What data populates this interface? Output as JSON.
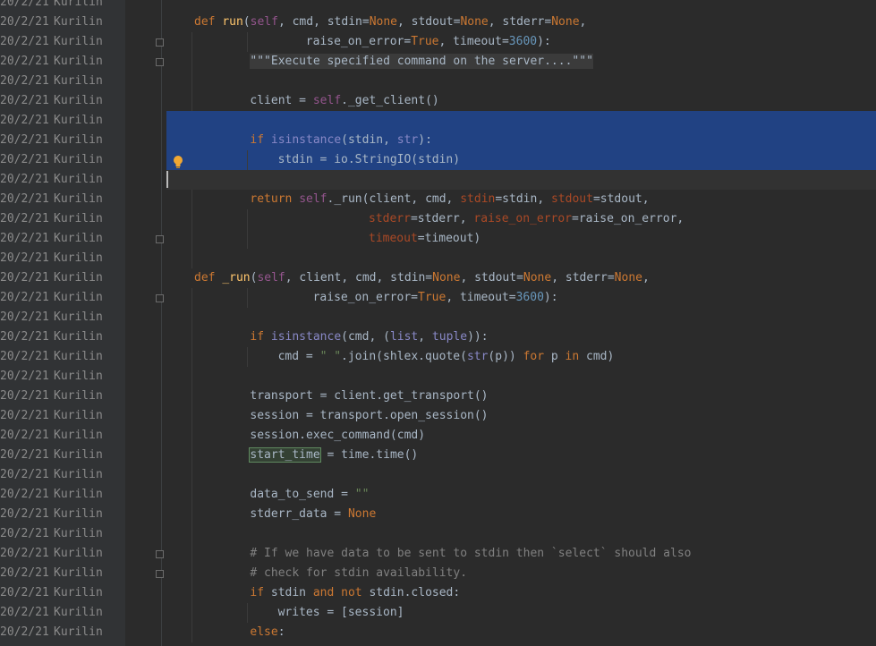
{
  "editor": {
    "annotation_rows": [
      {
        "date": "20/2/21",
        "author": "Kurilin"
      },
      {
        "date": "20/2/21",
        "author": "Kurilin"
      },
      {
        "date": "20/2/21",
        "author": "Kurilin"
      },
      {
        "date": "20/2/21",
        "author": "Kurilin"
      },
      {
        "date": "20/2/21",
        "author": "Kurilin"
      },
      {
        "date": "20/2/21",
        "author": "Kurilin"
      },
      {
        "date": "20/2/21",
        "author": "Kurilin"
      },
      {
        "date": "20/2/21",
        "author": "Kurilin"
      },
      {
        "date": "20/2/21",
        "author": "Kurilin"
      },
      {
        "date": "20/2/21",
        "author": "Kurilin"
      },
      {
        "date": "20/2/21",
        "author": "Kurilin"
      },
      {
        "date": "20/2/21",
        "author": "Kurilin"
      },
      {
        "date": "20/2/21",
        "author": "Kurilin"
      },
      {
        "date": "20/2/21",
        "author": "Kurilin"
      },
      {
        "date": "20/2/21",
        "author": "Kurilin"
      },
      {
        "date": "20/2/21",
        "author": "Kurilin"
      },
      {
        "date": "20/2/21",
        "author": "Kurilin"
      },
      {
        "date": "20/2/21",
        "author": "Kurilin"
      },
      {
        "date": "20/2/21",
        "author": "Kurilin"
      },
      {
        "date": "20/2/21",
        "author": "Kurilin"
      },
      {
        "date": "20/2/21",
        "author": "Kurilin"
      },
      {
        "date": "20/2/21",
        "author": "Kurilin"
      },
      {
        "date": "20/2/21",
        "author": "Kurilin"
      },
      {
        "date": "20/2/21",
        "author": "Kurilin"
      },
      {
        "date": "20/2/21",
        "author": "Kurilin"
      },
      {
        "date": "20/2/21",
        "author": "Kurilin"
      },
      {
        "date": "20/2/21",
        "author": "Kurilin"
      },
      {
        "date": "20/2/21",
        "author": "Kurilin"
      },
      {
        "date": "20/2/21",
        "author": "Kurilin"
      },
      {
        "date": "20/2/21",
        "author": "Kurilin"
      },
      {
        "date": "20/2/21",
        "author": "Kurilin"
      },
      {
        "date": "20/2/21",
        "author": "Kurilin"
      },
      {
        "date": "20/2/21",
        "author": "Kurilin"
      }
    ],
    "code_lines": [
      {
        "indent": 0,
        "tokens": [
          [
            "def ",
            "kw"
          ],
          [
            "run",
            "fn"
          ],
          [
            "(",
            ""
          ],
          [
            "self",
            "self"
          ],
          [
            ", cmd, stdin=",
            ""
          ],
          [
            "None",
            "kw"
          ],
          [
            ", stdout=",
            ""
          ],
          [
            "None",
            "kw"
          ],
          [
            ", stderr=",
            ""
          ],
          [
            "None",
            "kw"
          ],
          [
            ",",
            ""
          ]
        ]
      },
      {
        "indent": 16,
        "tokens": [
          [
            "raise_on_error=",
            ""
          ],
          [
            "True",
            "kw"
          ],
          [
            ", timeout=",
            ""
          ],
          [
            "3600",
            "num"
          ],
          [
            "):",
            ""
          ]
        ]
      },
      {
        "indent": 8,
        "tokens": [
          [
            "\"\"\"Execute specified command on the server....\"\"\"",
            "doc"
          ]
        ]
      },
      {
        "indent": 0,
        "tokens": []
      },
      {
        "indent": 8,
        "tokens": [
          [
            "client = ",
            ""
          ],
          [
            "self",
            "self"
          ],
          [
            "._get_client()",
            ""
          ]
        ]
      },
      {
        "indent": 0,
        "tokens": [],
        "state": "sel"
      },
      {
        "indent": 8,
        "tokens": [
          [
            "if ",
            "kw"
          ],
          [
            "isinstance",
            "bi"
          ],
          [
            "(stdin, ",
            ""
          ],
          [
            "str",
            "bi"
          ],
          [
            "):",
            ""
          ]
        ],
        "state": "sel"
      },
      {
        "indent": 12,
        "tokens": [
          [
            "stdin = io.StringIO(stdin)",
            ""
          ]
        ],
        "state": "sel"
      },
      {
        "indent": 0,
        "tokens": [],
        "state": "cur"
      },
      {
        "indent": 8,
        "tokens": [
          [
            "return ",
            "kw"
          ],
          [
            "self",
            "self"
          ],
          [
            "._run(client, cmd, ",
            ""
          ],
          [
            "stdin",
            "par"
          ],
          [
            "=stdin, ",
            ""
          ],
          [
            "stdout",
            "par"
          ],
          [
            "=stdout,",
            ""
          ]
        ]
      },
      {
        "indent": 25,
        "tokens": [
          [
            "stderr",
            "par"
          ],
          [
            "=stderr, ",
            ""
          ],
          [
            "raise_on_error",
            "par"
          ],
          [
            "=raise_on_error,",
            ""
          ]
        ]
      },
      {
        "indent": 25,
        "tokens": [
          [
            "timeout",
            "par"
          ],
          [
            "=timeout)",
            ""
          ]
        ]
      },
      {
        "indent": 0,
        "tokens": []
      },
      {
        "indent": 0,
        "tokens": [
          [
            "def ",
            "kw"
          ],
          [
            "_run",
            "fn"
          ],
          [
            "(",
            ""
          ],
          [
            "self",
            "self"
          ],
          [
            ", client, cmd, stdin=",
            ""
          ],
          [
            "None",
            "kw"
          ],
          [
            ", stdout=",
            ""
          ],
          [
            "None",
            "kw"
          ],
          [
            ", stderr=",
            ""
          ],
          [
            "None",
            "kw"
          ],
          [
            ",",
            ""
          ]
        ]
      },
      {
        "indent": 17,
        "tokens": [
          [
            "raise_on_error=",
            ""
          ],
          [
            "True",
            "kw"
          ],
          [
            ", timeout=",
            ""
          ],
          [
            "3600",
            "num"
          ],
          [
            "):",
            ""
          ]
        ]
      },
      {
        "indent": 0,
        "tokens": []
      },
      {
        "indent": 8,
        "tokens": [
          [
            "if ",
            "kw"
          ],
          [
            "isinstance",
            "bi"
          ],
          [
            "(cmd, (",
            ""
          ],
          [
            "list",
            "bi"
          ],
          [
            ", ",
            ""
          ],
          [
            "tuple",
            "bi"
          ],
          [
            ")):",
            ""
          ]
        ]
      },
      {
        "indent": 12,
        "tokens": [
          [
            "cmd = ",
            ""
          ],
          [
            "\" \"",
            "str"
          ],
          [
            ".join(shlex.quote(",
            ""
          ],
          [
            "str",
            "bi"
          ],
          [
            "(p)) ",
            ""
          ],
          [
            "for ",
            "kw"
          ],
          [
            "p ",
            ""
          ],
          [
            "in ",
            "kw"
          ],
          [
            "cmd)",
            ""
          ]
        ]
      },
      {
        "indent": 0,
        "tokens": []
      },
      {
        "indent": 8,
        "tokens": [
          [
            "transport = client.get_transport()",
            ""
          ]
        ]
      },
      {
        "indent": 8,
        "tokens": [
          [
            "session = transport.open_session()",
            ""
          ]
        ]
      },
      {
        "indent": 8,
        "tokens": [
          [
            "session.exec_command(cmd)",
            ""
          ]
        ]
      },
      {
        "indent": 8,
        "tokens": [
          [
            "start_time",
            "usage"
          ],
          [
            " = time.time()",
            ""
          ]
        ]
      },
      {
        "indent": 0,
        "tokens": []
      },
      {
        "indent": 8,
        "tokens": [
          [
            "data_to_send = ",
            ""
          ],
          [
            "\"\"",
            "str"
          ]
        ]
      },
      {
        "indent": 8,
        "tokens": [
          [
            "stderr_data = ",
            ""
          ],
          [
            "None",
            "kw"
          ]
        ]
      },
      {
        "indent": 0,
        "tokens": []
      },
      {
        "indent": 8,
        "tokens": [
          [
            "# If we have data to be sent to stdin then `select` should also",
            "cmt"
          ]
        ]
      },
      {
        "indent": 8,
        "tokens": [
          [
            "# check for stdin availability.",
            "cmt"
          ]
        ]
      },
      {
        "indent": 8,
        "tokens": [
          [
            "if ",
            "kw"
          ],
          [
            "stdin ",
            ""
          ],
          [
            "and not ",
            "kw"
          ],
          [
            "stdin.closed:",
            ""
          ]
        ]
      },
      {
        "indent": 12,
        "tokens": [
          [
            "writes = [session]",
            ""
          ]
        ]
      },
      {
        "indent": 8,
        "tokens": [
          [
            "else",
            "kw"
          ],
          [
            ":",
            ""
          ]
        ]
      }
    ],
    "colors": {
      "background": "#2b2b2b",
      "keyword": "#cc7832",
      "function": "#ffc66d",
      "self": "#94558d",
      "number": "#6897bb",
      "string": "#6a8759",
      "builtin": "#8888c6",
      "comment": "#808080",
      "selection": "#214283"
    }
  }
}
